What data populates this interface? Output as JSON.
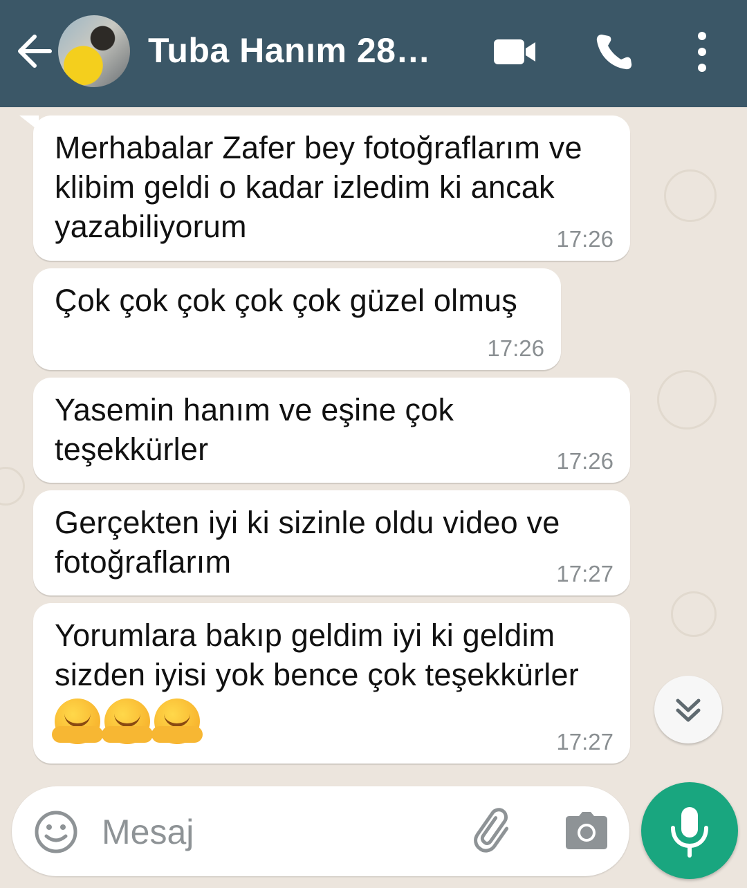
{
  "header": {
    "title": "Tuba Hanım 28…",
    "back_icon": "arrow-left-icon",
    "video_icon": "videocam-icon",
    "call_icon": "phone-icon",
    "menu_icon": "more-vertical-icon"
  },
  "messages": [
    {
      "text": "Merhabalar Zafer bey fotoğraflarım ve klibim geldi o kadar izledim ki ancak yazabiliyorum",
      "time": "17:26"
    },
    {
      "text": "Çok çok çok çok çok güzel olmuş",
      "time": "17:26"
    },
    {
      "text": "Yasemin hanım ve eşine çok teşekkürler",
      "time": "17:26"
    },
    {
      "text": "Gerçekten iyi ki sizinle oldu video ve fotoğraflarım",
      "time": "17:27"
    },
    {
      "text": "Yorumlara bakıp geldim iyi ki geldim sizden iyisi yok bence çok teşekkürler",
      "time": "17:27",
      "emoji": [
        "hugging-face",
        "hugging-face",
        "hugging-face"
      ]
    }
  ],
  "composer": {
    "placeholder": "Mesaj",
    "emoji_icon": "smiley-icon",
    "attach_icon": "paperclip-icon",
    "camera_icon": "camera-icon",
    "mic_icon": "mic-icon"
  },
  "colors": {
    "header": "#3b5767",
    "chat_background": "#ece5dd",
    "incoming_bubble": "#ffffff",
    "mic_button": "#19a67f",
    "timestamp": "#8a8f92"
  }
}
